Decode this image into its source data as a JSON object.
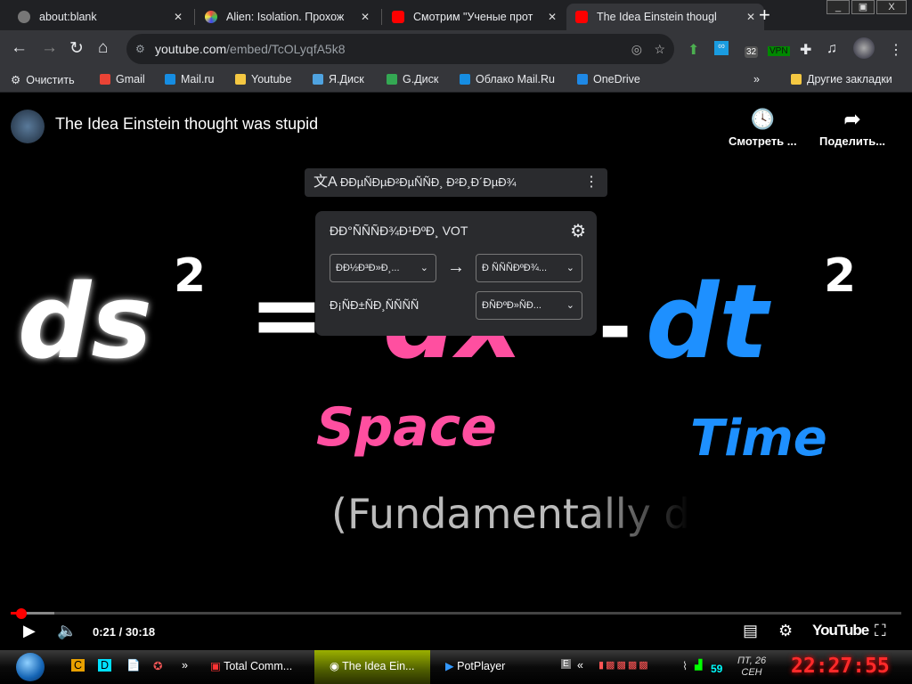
{
  "tabs": [
    {
      "label": "about:blank",
      "icon": "globe-icon",
      "color": "#777777"
    },
    {
      "label": "Alien: Isolation. Прохож",
      "icon": "multicolor-icon",
      "color": "#a66dd4"
    },
    {
      "label": "Смотрим \"Ученые прот",
      "icon": "youtube-icon",
      "color": "#ff0000"
    },
    {
      "label": "The Idea Einstein thougl",
      "icon": "youtube-icon",
      "color": "#ff0000"
    }
  ],
  "window": {
    "minimize": "_",
    "restore": "▣",
    "close": "X"
  },
  "url": {
    "host": "youtube.com",
    "path": "/embed/TcOLyqfA5k8"
  },
  "extensions": {
    "badge_count": "32",
    "vpn": "VPN"
  },
  "bookmarks": [
    {
      "label": "Очистить",
      "color": "#e8eaed"
    },
    {
      "label": "Gmail",
      "color": "#ea4335"
    },
    {
      "label": "Mail.ru",
      "color": "#168de2"
    },
    {
      "label": "Youtube",
      "color": "#f5c842"
    },
    {
      "label": "Я.Диск",
      "color": "#4fa3e0"
    },
    {
      "label": "G.Диск",
      "color": "#34a853"
    },
    {
      "label": "Облако Mail.Ru",
      "color": "#168de2"
    },
    {
      "label": "OneDrive",
      "color": "#1e88e5"
    }
  ],
  "bookmarks_more": "»",
  "other_bookmarks": "Другие закладки",
  "video": {
    "title": "The Idea Einstein thought was stupid",
    "watch_later": "Смотреть ...",
    "share": "Поделить...",
    "eq": {
      "ds": "ds",
      "sq": "2",
      "eqs": "=",
      "dx": "dx",
      "minus": "-",
      "dt": "dt",
      "space": "Space",
      "time": "Time",
      "fund": "(Fundamentally d"
    }
  },
  "vot": {
    "bar_label": "ĐĐµÑĐµĐ²ĐµÑÑĐ¸ Đ²Đ¸Đ´ĐµĐ¾",
    "panel_title": "ĐĐ°ÑÑÑĐ¾Đ¹ĐºĐ¸ VOT",
    "from_lang": "ĐĐ½Đ³Đ»Đ¸...",
    "arrow": "→",
    "to_lang": "Đ ÑÑÑĐºĐ¾...",
    "subs_label": "Đ¡ÑĐ±ÑĐ¸ÑÑÑÑ",
    "subs_value": "ĐÑĐºĐ»ÑĐ..."
  },
  "player": {
    "time": "0:21 / 30:18",
    "progress_percent": 1.2,
    "loaded_percent": 4.9,
    "logo": "YouTube"
  },
  "taskbar": {
    "items": [
      "Total Comm...",
      "The Idea Ein...",
      "PotPlayer"
    ],
    "quick": [
      "C",
      "D"
    ],
    "chevron": "»",
    "tray_chevron": "«",
    "tray_e": "E",
    "net": "59",
    "date_line1": "ПТ, 26",
    "date_line2": "СЕН",
    "clock": "22:27:55"
  }
}
